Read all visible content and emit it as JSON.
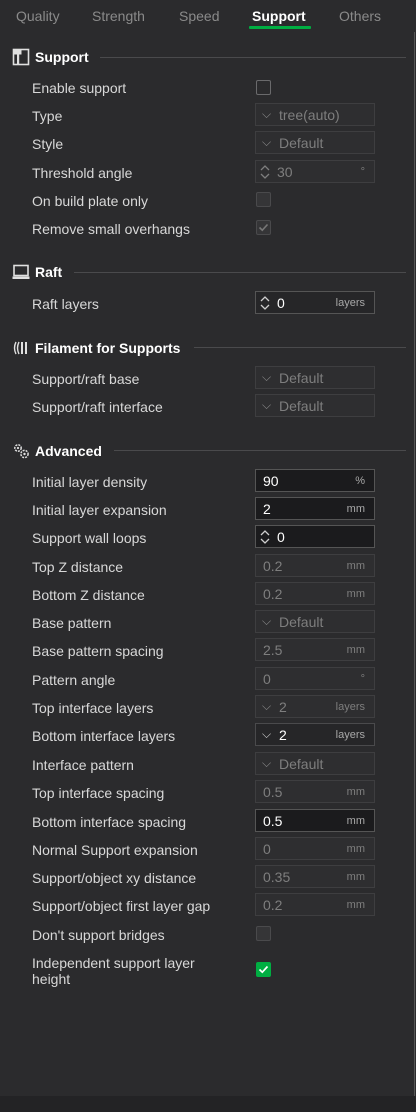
{
  "tabs": [
    "Quality",
    "Strength",
    "Speed",
    "Support",
    "Others"
  ],
  "active_tab": "Support",
  "accent_color": "#00ae42",
  "sections": {
    "support": {
      "title": "Support",
      "icon": "support-icon",
      "enable_support": {
        "label": "Enable support",
        "checked": false
      },
      "type": {
        "label": "Type",
        "value": "tree(auto)"
      },
      "style": {
        "label": "Style",
        "value": "Default"
      },
      "threshold_angle": {
        "label": "Threshold angle",
        "value": "30",
        "unit": "°"
      },
      "on_build_plate_only": {
        "label": "On build plate only",
        "checked": false
      },
      "remove_small_overhangs": {
        "label": "Remove small overhangs",
        "checked": true
      }
    },
    "raft": {
      "title": "Raft",
      "icon": "raft-icon",
      "raft_layers": {
        "label": "Raft layers",
        "value": "0",
        "unit": "layers"
      }
    },
    "filament": {
      "title": "Filament for Supports",
      "icon": "filament-icon",
      "raft_base": {
        "label": "Support/raft base",
        "value": "Default"
      },
      "raft_interface": {
        "label": "Support/raft interface",
        "value": "Default"
      }
    },
    "advanced": {
      "title": "Advanced",
      "icon": "gears-icon",
      "initial_layer_density": {
        "label": "Initial layer density",
        "value": "90",
        "unit": "%"
      },
      "initial_layer_expansion": {
        "label": "Initial layer expansion",
        "value": "2",
        "unit": "mm"
      },
      "support_wall_loops": {
        "label": "Support wall loops",
        "value": "0"
      },
      "top_z_distance": {
        "label": "Top Z distance",
        "value": "0.2",
        "unit": "mm"
      },
      "bottom_z_distance": {
        "label": "Bottom Z distance",
        "value": "0.2",
        "unit": "mm"
      },
      "base_pattern": {
        "label": "Base pattern",
        "value": "Default"
      },
      "base_pattern_spacing": {
        "label": "Base pattern spacing",
        "value": "2.5",
        "unit": "mm"
      },
      "pattern_angle": {
        "label": "Pattern angle",
        "value": "0",
        "unit": "°"
      },
      "top_interface_layers": {
        "label": "Top interface layers",
        "value": "2",
        "unit": "layers"
      },
      "bottom_interface_layers": {
        "label": "Bottom interface layers",
        "value": "2",
        "unit": "layers"
      },
      "interface_pattern": {
        "label": "Interface pattern",
        "value": "Default"
      },
      "top_interface_spacing": {
        "label": "Top interface spacing",
        "value": "0.5",
        "unit": "mm"
      },
      "bottom_interface_spacing": {
        "label": "Bottom interface spacing",
        "value": "0.5",
        "unit": "mm"
      },
      "normal_support_expansion": {
        "label": "Normal Support expansion",
        "value": "0",
        "unit": "mm"
      },
      "support_object_xy_distance": {
        "label": "Support/object xy distance",
        "value": "0.35",
        "unit": "mm"
      },
      "support_object_first_layer_gap": {
        "label": "Support/object first layer gap",
        "value": "0.2",
        "unit": "mm"
      },
      "dont_support_bridges": {
        "label": "Don't support bridges",
        "checked": false
      },
      "independent_support_layer_height": {
        "label_line1": "Independent support layer",
        "label_line2": "height",
        "checked": true
      }
    }
  }
}
